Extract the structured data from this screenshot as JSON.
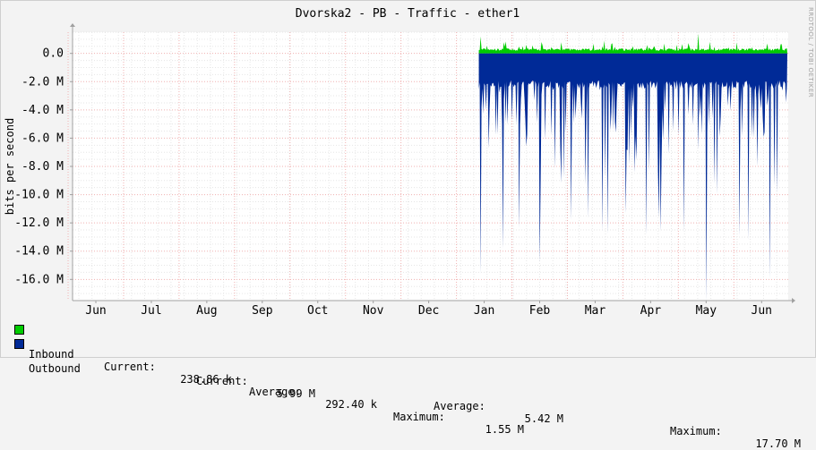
{
  "chart_data": {
    "type": "area",
    "title": "Dvorska2 - PB - Traffic - ether1",
    "ylabel": "bits per second",
    "xlabel": "",
    "x_ticks": [
      "Jun",
      "Jul",
      "Aug",
      "Sep",
      "Oct",
      "Nov",
      "Dec",
      "Jan",
      "Feb",
      "Mar",
      "Apr",
      "May",
      "Jun"
    ],
    "y_ticks": [
      "0.0",
      "-2.0 M",
      "-4.0 M",
      "-6.0 M",
      "-8.0 M",
      "-10.0 M",
      "-12.0 M",
      "-14.0 M",
      "-16.0 M"
    ],
    "ylim": [
      -17.5,
      1.5
    ],
    "y_unit": "M",
    "grid": true,
    "series": [
      {
        "name": "Inbound",
        "color": "#00cc00",
        "data_start": "Jan",
        "data_end": "Jun",
        "typical": 0.3,
        "peaks": [
          {
            "at": "Jan",
            "value": 1.2
          },
          {
            "at": "Feb",
            "value": 0.6
          },
          {
            "at": "Mar",
            "value": 0.9
          },
          {
            "at": "Apr",
            "value": 0.6
          },
          {
            "at": "May",
            "value": 1.4
          },
          {
            "at": "Jun",
            "value": 0.7
          }
        ]
      },
      {
        "name": "Outbound",
        "color": "#002a97",
        "data_start": "Jan",
        "data_end": "Jun",
        "typical": -2.2,
        "peaks": [
          {
            "at": "Jan",
            "value": -15.6
          },
          {
            "at": "Feb",
            "value": -14.8
          },
          {
            "at": "Mar",
            "value": -12.8
          },
          {
            "at": "Apr",
            "value": -12.6
          },
          {
            "at": "May",
            "value": -17.5
          },
          {
            "at": "Jun",
            "value": -15.9
          }
        ]
      }
    ]
  },
  "legend": {
    "inbound": {
      "name": "Inbound",
      "current_label": "Current:",
      "current": "238.86 k",
      "average_label": "Average:",
      "average": "292.40 k",
      "maximum_label": "Maximum:",
      "maximum": "1.55 M"
    },
    "outbound": {
      "name": "Outbound",
      "current_label": "Current:",
      "current": "5.99 M",
      "average_label": "Average:",
      "average": "5.42 M",
      "maximum_label": "Maximum:",
      "maximum": "17.70 M"
    }
  },
  "credit": "RRDTOOL / TOBI OETIKER"
}
